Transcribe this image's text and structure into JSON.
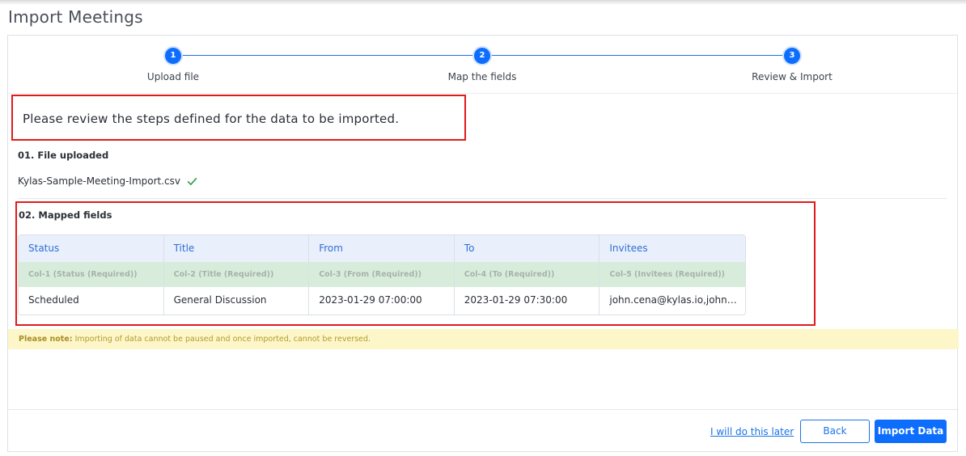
{
  "page": {
    "title": "Import Meetings"
  },
  "stepper": {
    "steps": [
      {
        "number": "1",
        "label": "Upload file"
      },
      {
        "number": "2",
        "label": "Map the fields"
      },
      {
        "number": "3",
        "label": "Review & Import"
      }
    ]
  },
  "review": {
    "message": "Please review the steps defined for the data to be imported."
  },
  "file_section": {
    "title": "01. File uploaded",
    "file_name": "Kylas-Sample-Meeting-Import.csv",
    "status_icon": "check-icon"
  },
  "mapped_section": {
    "title": "02. Mapped fields",
    "columns": [
      "Status",
      "Title",
      "From",
      "To",
      "Invitees"
    ],
    "mappings": [
      "Col-1 (Status (Required))",
      "Col-2 (Title (Required))",
      "Col-3 (From (Required))",
      "Col-4 (To (Required))",
      "Col-5 (Invitees (Required))"
    ],
    "row": [
      "Scheduled",
      "General Discussion",
      "2023-01-29 07:00:00",
      "2023-01-29 07:30:00",
      "john.cena@kylas.io,john.d..."
    ]
  },
  "note": {
    "label": "Please note:",
    "text": " Importing of data cannot be paused and once imported, cannot be reversed."
  },
  "footer": {
    "later_link": "I will do this later",
    "back_label": "Back",
    "import_label": "Import Data"
  },
  "colors": {
    "accent": "#0d6efd",
    "highlight_border": "#e01b1b",
    "success": "#2e9e44",
    "note_bg": "#fdf6c9"
  }
}
